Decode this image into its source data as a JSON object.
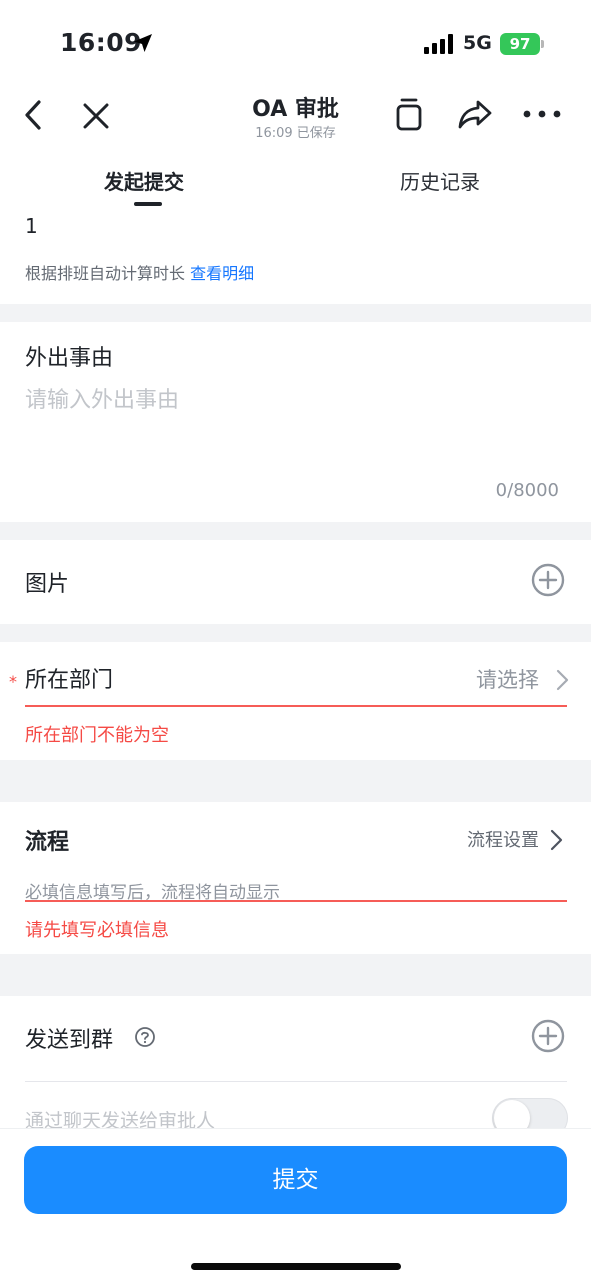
{
  "status_bar": {
    "time": "16:09",
    "network": "5G",
    "battery": "97"
  },
  "nav": {
    "title": "OA 审批",
    "subtitle": "16:09 已保存"
  },
  "tabs": [
    {
      "label": "发起提交",
      "active": true
    },
    {
      "label": "历史记录",
      "active": false
    }
  ],
  "duration": {
    "value": "1",
    "hint": "根据排班自动计算时长",
    "link": "查看明细"
  },
  "reason": {
    "label": "外出事由",
    "placeholder": "请输入外出事由",
    "counter": "0/8000"
  },
  "images": {
    "label": "图片"
  },
  "department": {
    "required_mark": "*",
    "label": "所在部门",
    "value": "请选择",
    "error": "所在部门不能为空"
  },
  "process": {
    "label": "流程",
    "settings_label": "流程设置",
    "hint": "必填信息填写后，流程将自动显示",
    "error": "请先填写必填信息"
  },
  "send_to_group": {
    "label": "发送到群",
    "chat_hint": "通过聊天发送给审批人",
    "toggle_on": false
  },
  "footer": {
    "submit_label": "提交"
  },
  "colors": {
    "accent": "#1a8cff",
    "link": "#1677ff",
    "error": "#f54a45",
    "battery": "#34c759"
  },
  "icons": [
    "location-arrow-icon",
    "signal-icon",
    "battery-icon",
    "back-icon",
    "close-icon",
    "copy-icon",
    "share-icon",
    "more-icon",
    "add-icon",
    "chevron-right-icon",
    "help-icon"
  ]
}
